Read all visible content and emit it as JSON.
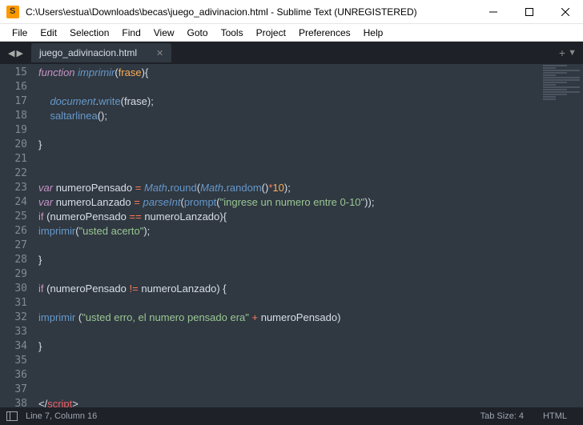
{
  "titlebar": {
    "title": "C:\\Users\\estua\\Downloads\\becas\\juego_adivinacion.html - Sublime Text (UNREGISTERED)"
  },
  "menu": {
    "file": "File",
    "edit": "Edit",
    "selection": "Selection",
    "find": "Find",
    "view": "View",
    "goto": "Goto",
    "tools": "Tools",
    "project": "Project",
    "preferences": "Preferences",
    "help": "Help"
  },
  "tab": {
    "name": "juego_adivinacion.html"
  },
  "gutter": {
    "start": 15,
    "end": 38
  },
  "code": {
    "l15": {
      "kw": "function",
      "fn": "imprimir",
      "param": "frase"
    },
    "l17": {
      "obj": "document",
      "method": "write",
      "arg": "frase"
    },
    "l18": {
      "fn": "saltarlinea"
    },
    "l23": {
      "kw": "var",
      "name": "numeroPensado",
      "obj": "Math",
      "m1": "round",
      "m2": "random",
      "num": "10"
    },
    "l24": {
      "kw": "var",
      "name": "numeroLanzado",
      "fn1": "parseInt",
      "fn2": "prompt",
      "str": "\"ingrese un numero entre 0-10\""
    },
    "l25": {
      "kw": "if",
      "a": "numeroPensado",
      "op": "==",
      "b": "numeroLanzado"
    },
    "l26": {
      "fn": "imprimir",
      "str": "\"usted acerto\""
    },
    "l30": {
      "kw": "if",
      "a": "numeroPensado",
      "op": "!=",
      "b": "numeroLanzado"
    },
    "l32": {
      "fn": "imprimir",
      "str": "\"usted erro, el numero pensado era\"",
      "plus": "+",
      "var": "numeroPensado"
    },
    "l38": {
      "tag": "script"
    }
  },
  "status": {
    "pos": "Line 7, Column 16",
    "tabsize": "Tab Size: 4",
    "lang": "HTML"
  }
}
